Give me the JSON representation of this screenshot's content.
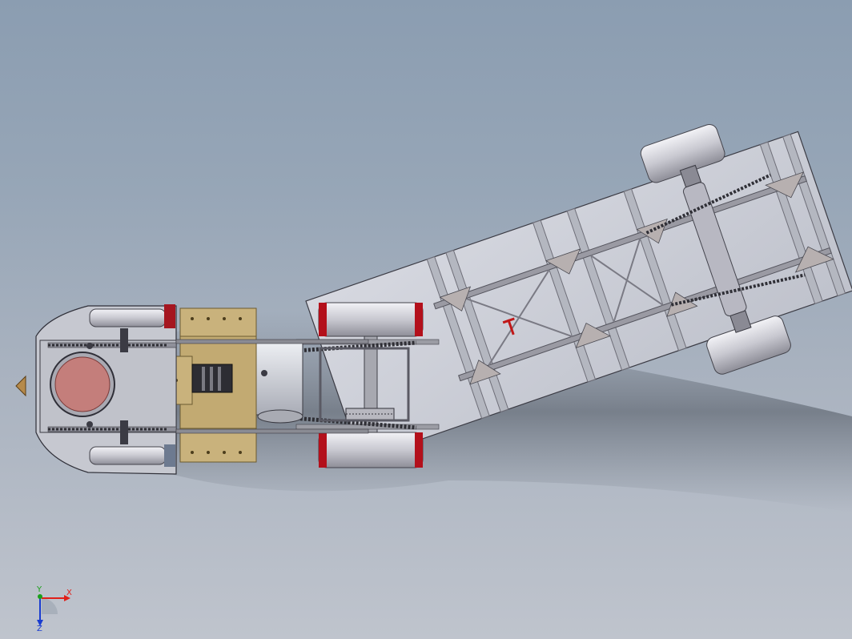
{
  "colors": {
    "background_top": "#8b9db1",
    "background_bottom": "#bfc4cd",
    "trailer_panel": "#c9ccd6",
    "frame_rail": "#8f8f96",
    "gusset": "#b9b4b4",
    "wheel": "#d6d6dc",
    "wheel_rim_red": "#b3101b",
    "engine_brass": "#c8b078",
    "firebox": "#c07a78",
    "chassis": "#c9cad2",
    "axis_x": "#e0201a",
    "axis_y": "#1aa01a",
    "axis_z": "#1a3cd0"
  },
  "triad": {
    "x_label": "X",
    "y_label": "Y",
    "z_label": "Z",
    "icon": "coordinate-triad-icon"
  }
}
